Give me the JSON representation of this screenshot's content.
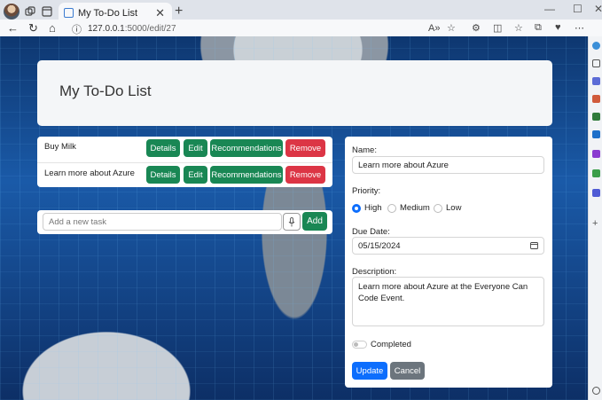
{
  "browser": {
    "tab_title": "My To-Do List",
    "tab_close": "✕",
    "new_tab": "+",
    "url_host": "127.0.0.1",
    "url_path": ":5000/edit/27",
    "icons": [
      "profile-avatar",
      "workspaces-icon",
      "tab-actions-icon",
      "back-icon",
      "refresh-icon",
      "home-icon",
      "info-icon",
      "read-aloud-icon",
      "favorite-icon",
      "extensions-icon",
      "split-screen-icon",
      "favorites-icon",
      "collections-icon",
      "copilot-icon",
      "more-icon"
    ]
  },
  "header": {
    "title": "My To-Do List"
  },
  "tasks": [
    {
      "name": "Buy Milk",
      "details": "Details",
      "edit": "Edit",
      "recommendations": "Recommendations",
      "remove": "Remove"
    },
    {
      "name": "Learn more about Azure",
      "details": "Details",
      "edit": "Edit",
      "recommendations": "Recommendations",
      "remove": "Remove"
    }
  ],
  "add": {
    "placeholder": "Add a new task",
    "button": "Add"
  },
  "form": {
    "name_label": "Name:",
    "name_value": "Learn more about Azure",
    "priority_label": "Priority:",
    "priority_options": [
      "High",
      "Medium",
      "Low"
    ],
    "priority_selected": "High",
    "due_label": "Due Date:",
    "due_value": "05/15/2024",
    "description_label": "Description:",
    "description_value": "Learn more about Azure at the Everyone Can Code Event.",
    "completed_label": "Completed",
    "completed": false,
    "update": "Update",
    "cancel": "Cancel"
  },
  "colors": {
    "success": "#198754",
    "danger": "#dc3545",
    "primary": "#0d6efd",
    "secondary": "#6c757d"
  }
}
